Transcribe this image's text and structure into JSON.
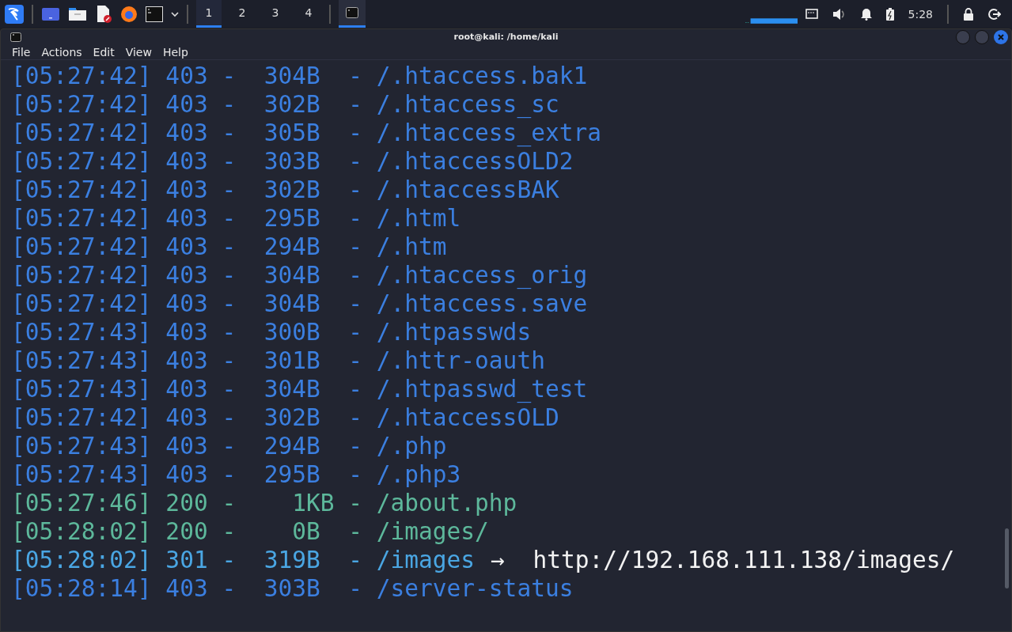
{
  "taskbar": {
    "workspaces": [
      {
        "label": "1",
        "selected": true
      },
      {
        "label": "2",
        "selected": false
      },
      {
        "label": "3",
        "selected": false
      },
      {
        "label": "4",
        "selected": false
      }
    ],
    "clock": "5:28"
  },
  "window": {
    "title": "root@kali: /home/kali"
  },
  "menu": [
    "File",
    "Actions",
    "Edit",
    "View",
    "Help"
  ],
  "lines": [
    {
      "text": "[05:27:42] 403 -  304B  - /.htaccess.bak1",
      "color": "#3b7fe0"
    },
    {
      "text": "[05:27:42] 403 -  302B  - /.htaccess_sc",
      "color": "#3b7fe0"
    },
    {
      "text": "[05:27:42] 403 -  305B  - /.htaccess_extra",
      "color": "#3b7fe0"
    },
    {
      "text": "[05:27:42] 403 -  303B  - /.htaccessOLD2",
      "color": "#3b7fe0"
    },
    {
      "text": "[05:27:42] 403 -  302B  - /.htaccessBAK",
      "color": "#3b7fe0"
    },
    {
      "text": "[05:27:42] 403 -  295B  - /.html",
      "color": "#3b7fe0"
    },
    {
      "text": "[05:27:42] 403 -  294B  - /.htm",
      "color": "#3b7fe0"
    },
    {
      "text": "[05:27:42] 403 -  304B  - /.htaccess_orig",
      "color": "#3b7fe0"
    },
    {
      "text": "[05:27:42] 403 -  304B  - /.htaccess.save",
      "color": "#3b7fe0"
    },
    {
      "text": "[05:27:43] 403 -  300B  - /.htpasswds",
      "color": "#3b7fe0"
    },
    {
      "text": "[05:27:43] 403 -  301B  - /.httr-oauth",
      "color": "#3b7fe0"
    },
    {
      "text": "[05:27:43] 403 -  304B  - /.htpasswd_test",
      "color": "#3b7fe0"
    },
    {
      "text": "[05:27:42] 403 -  302B  - /.htaccessOLD",
      "color": "#3b7fe0"
    },
    {
      "text": "[05:27:43] 403 -  294B  - /.php",
      "color": "#3b7fe0"
    },
    {
      "text": "[05:27:43] 403 -  295B  - /.php3",
      "color": "#3b7fe0"
    },
    {
      "text": "[05:27:46] 200 -    1KB - /about.php",
      "color": "#5db89b"
    },
    {
      "text": "[05:28:02] 200 -    0B  - /images/",
      "color": "#5db89b"
    },
    {
      "text": "[05:28:02] 301 -  319B  - /images",
      "color": "#4aa6e3",
      "redirect": "→  http://192.168.111.138/images/"
    },
    {
      "text": "[05:28:14] 403 -  303B  - /server-status",
      "color": "#3b7fe0"
    }
  ]
}
